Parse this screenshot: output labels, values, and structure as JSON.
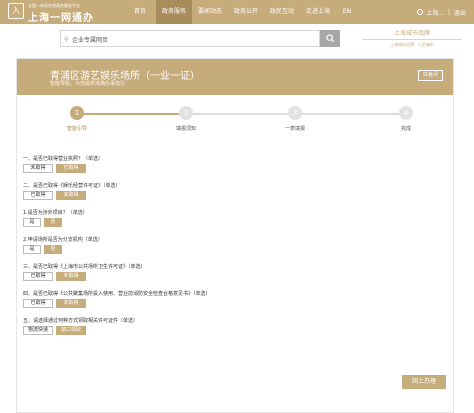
{
  "header": {
    "logo_glyph": "入",
    "brand_small": "全国一体化在线政务服务平台",
    "brand_big": "上海一网通办",
    "nav": [
      {
        "label": "首页",
        "w": 32
      },
      {
        "label": "政务服务",
        "w": 36,
        "active": true
      },
      {
        "label": "要闻动态",
        "w": 36
      },
      {
        "label": "政务公开",
        "w": 36
      },
      {
        "label": "政民互动",
        "w": 36
      },
      {
        "label": "走进上海",
        "w": 36
      },
      {
        "label": "EN",
        "w": 22
      }
    ],
    "user_text": "上海...",
    "logout": "退出"
  },
  "search": {
    "scope_label": "企业专属网页",
    "city_main": "上海城市品牌",
    "city_sub": "上海城市品牌 · 人民城市"
  },
  "card": {
    "title": "青浦区游艺娱乐场所（一业一证）",
    "subtitle": "智能导服，为您提供准确办事指引",
    "guide_button": "好差评"
  },
  "steps": [
    {
      "num": "1",
      "label": "智能引导",
      "active": true
    },
    {
      "num": "2",
      "label": "填报须知"
    },
    {
      "num": "3",
      "label": "一表填报"
    },
    {
      "num": "4",
      "label": "完成"
    }
  ],
  "questions": [
    {
      "title": "一、是否已取得营业执照？（单选）",
      "options": [
        {
          "label": "未取得"
        },
        {
          "label": "已取得",
          "selected": true
        }
      ]
    },
    {
      "title": "二、是否已取得《娱乐经营许可证》（单选）",
      "options": [
        {
          "label": "已取得"
        },
        {
          "label": "未取得",
          "selected": true
        }
      ]
    },
    {
      "title": "1.是否为涉外项目？（单选）",
      "options": [
        {
          "label": "是"
        },
        {
          "label": "否",
          "selected": true
        }
      ]
    },
    {
      "title": "2.申请场所是否为分支机构（单选）",
      "options": [
        {
          "label": "是"
        },
        {
          "label": "否",
          "selected": true
        }
      ]
    },
    {
      "title": "三、是否已取得《上海市公共场所卫生许可证》（单选）",
      "options": [
        {
          "label": "已取得"
        },
        {
          "label": "未取得",
          "selected": true
        }
      ]
    },
    {
      "title": "四、是否已取得《公共聚集场所投入使用、营业前消防安全检查合格意见书》（单选）",
      "options": [
        {
          "label": "已取得"
        },
        {
          "label": "未取得",
          "selected": true
        }
      ]
    },
    {
      "title": "五、请选择通过何种方式领取相关许可证件（单选）",
      "options": [
        {
          "label": "物流快递"
        },
        {
          "label": "窗口领取",
          "selected": true
        }
      ]
    }
  ],
  "submit_label": "网上办理",
  "colors": {
    "accent": "#c6ab7b",
    "accent_dark": "#a98c5b"
  }
}
